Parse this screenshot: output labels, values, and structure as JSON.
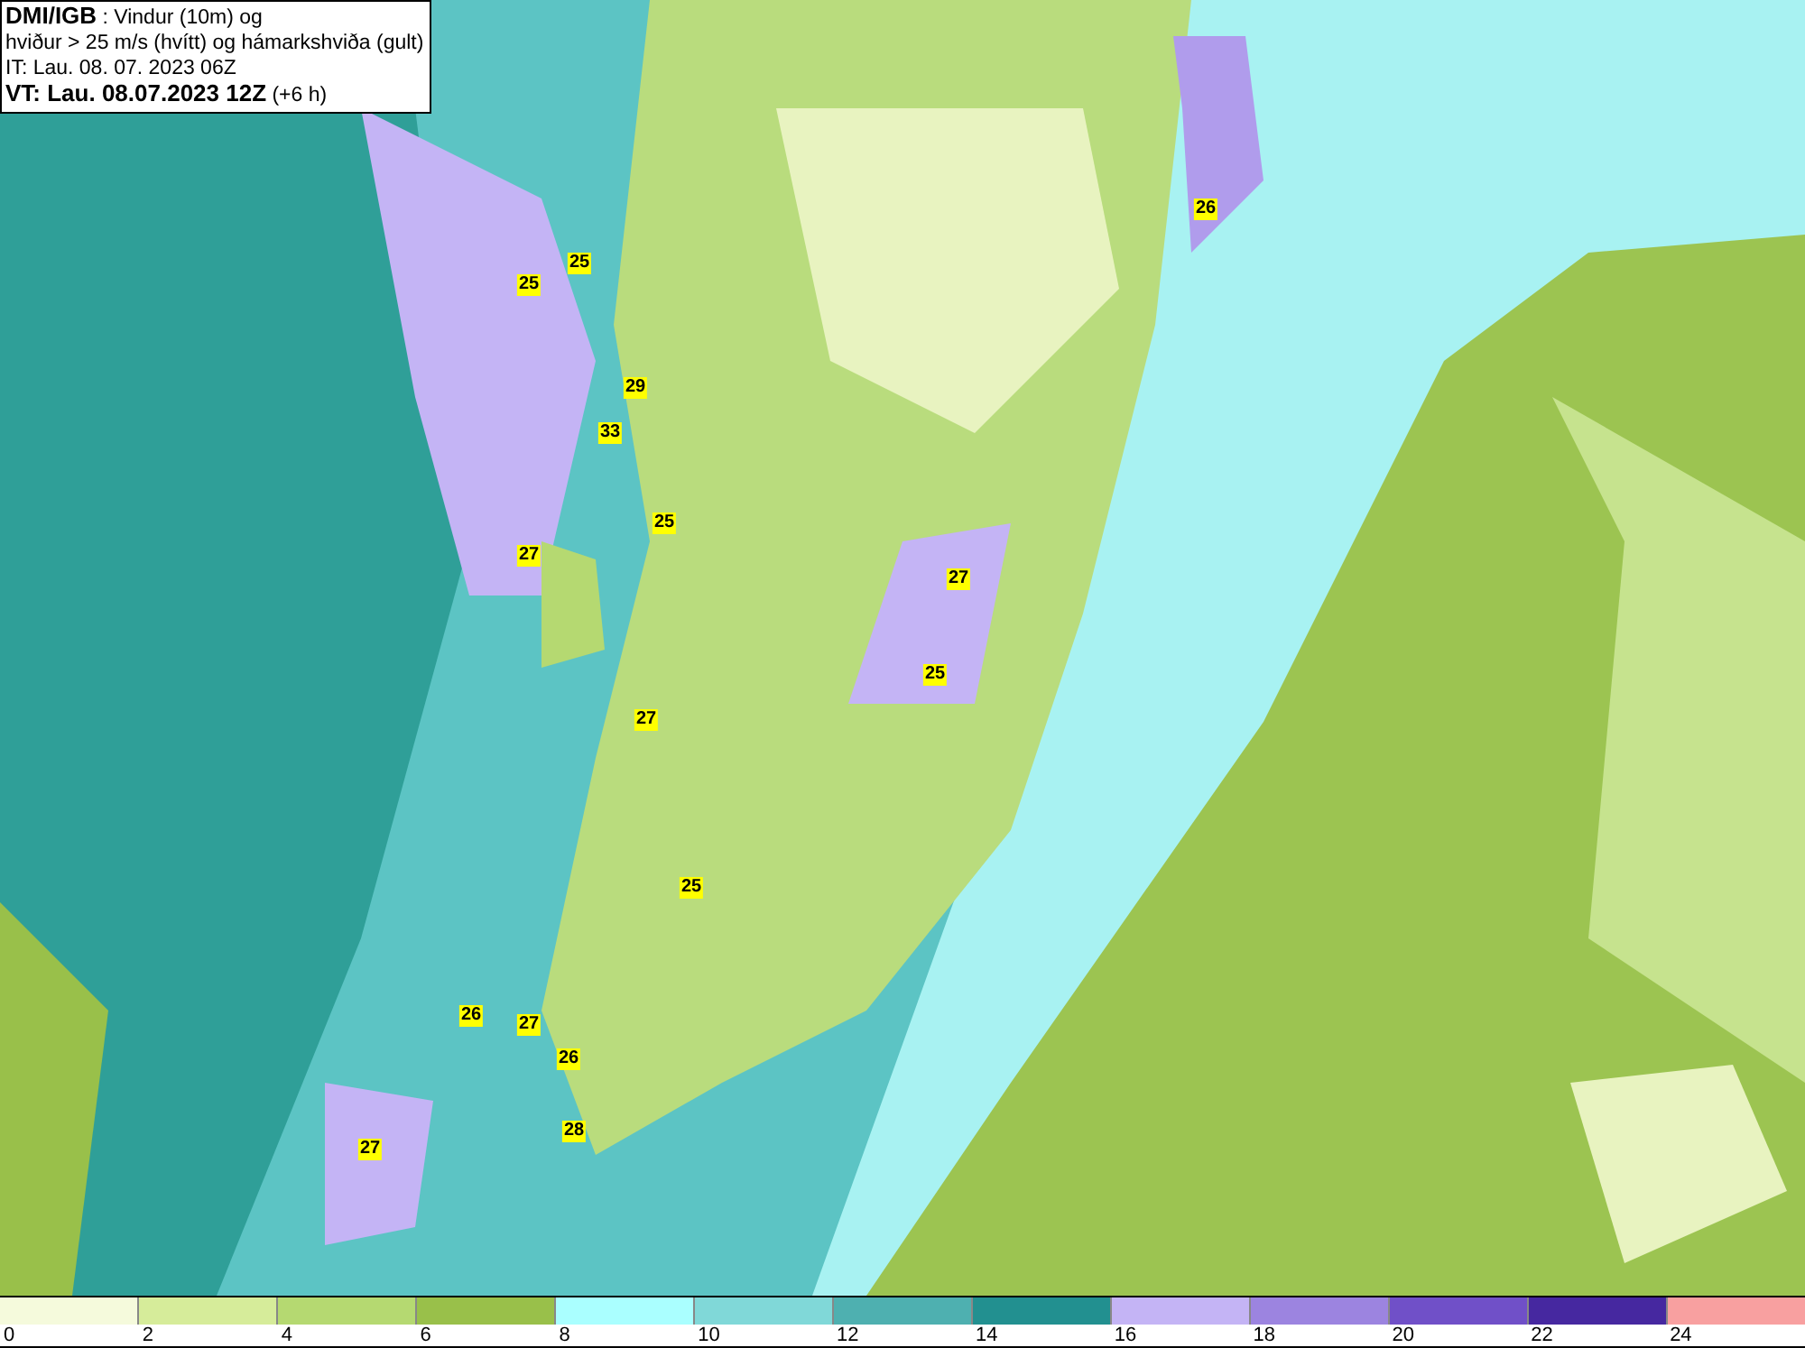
{
  "title_box": {
    "source": "DMI/IGB",
    "description": " : Vindur (10m) og",
    "line_2": "hviður > 25 m/s (hvítt) og hámarkshviða (gult)",
    "issue_time": "IT: Lau. 08. 07. 2023 06Z",
    "valid_time": "VT: Lau. 08.07.2023 12Z",
    "lead_time": " (+6 h)"
  },
  "map": {
    "gust_labels": [
      {
        "value": "26"
      },
      {
        "value": "25"
      },
      {
        "value": "25"
      },
      {
        "value": "29"
      },
      {
        "value": "33"
      },
      {
        "value": "25"
      },
      {
        "value": "27"
      },
      {
        "value": "27"
      },
      {
        "value": "25"
      },
      {
        "value": "27"
      },
      {
        "value": "25"
      },
      {
        "value": "26"
      },
      {
        "value": "27"
      },
      {
        "value": "26"
      },
      {
        "value": "28"
      },
      {
        "value": "27"
      }
    ]
  },
  "legend": {
    "bins": [
      {
        "label": "0",
        "color": "#f5fadc"
      },
      {
        "label": "2",
        "color": "#d6ec9a"
      },
      {
        "label": "4",
        "color": "#b5d971"
      },
      {
        "label": "6",
        "color": "#99c04a"
      },
      {
        "label": "8",
        "color": "#aaffff"
      },
      {
        "label": "10",
        "color": "#80d8d8"
      },
      {
        "label": "12",
        "color": "#4eb0b0"
      },
      {
        "label": "14",
        "color": "#229090"
      },
      {
        "label": "16",
        "color": "#c4b4f5"
      },
      {
        "label": "18",
        "color": "#9c84e0"
      },
      {
        "label": "20",
        "color": "#7050c8"
      },
      {
        "label": "22",
        "color": "#4628a0"
      },
      {
        "label": "24",
        "color": "#f8a0a0"
      }
    ]
  }
}
